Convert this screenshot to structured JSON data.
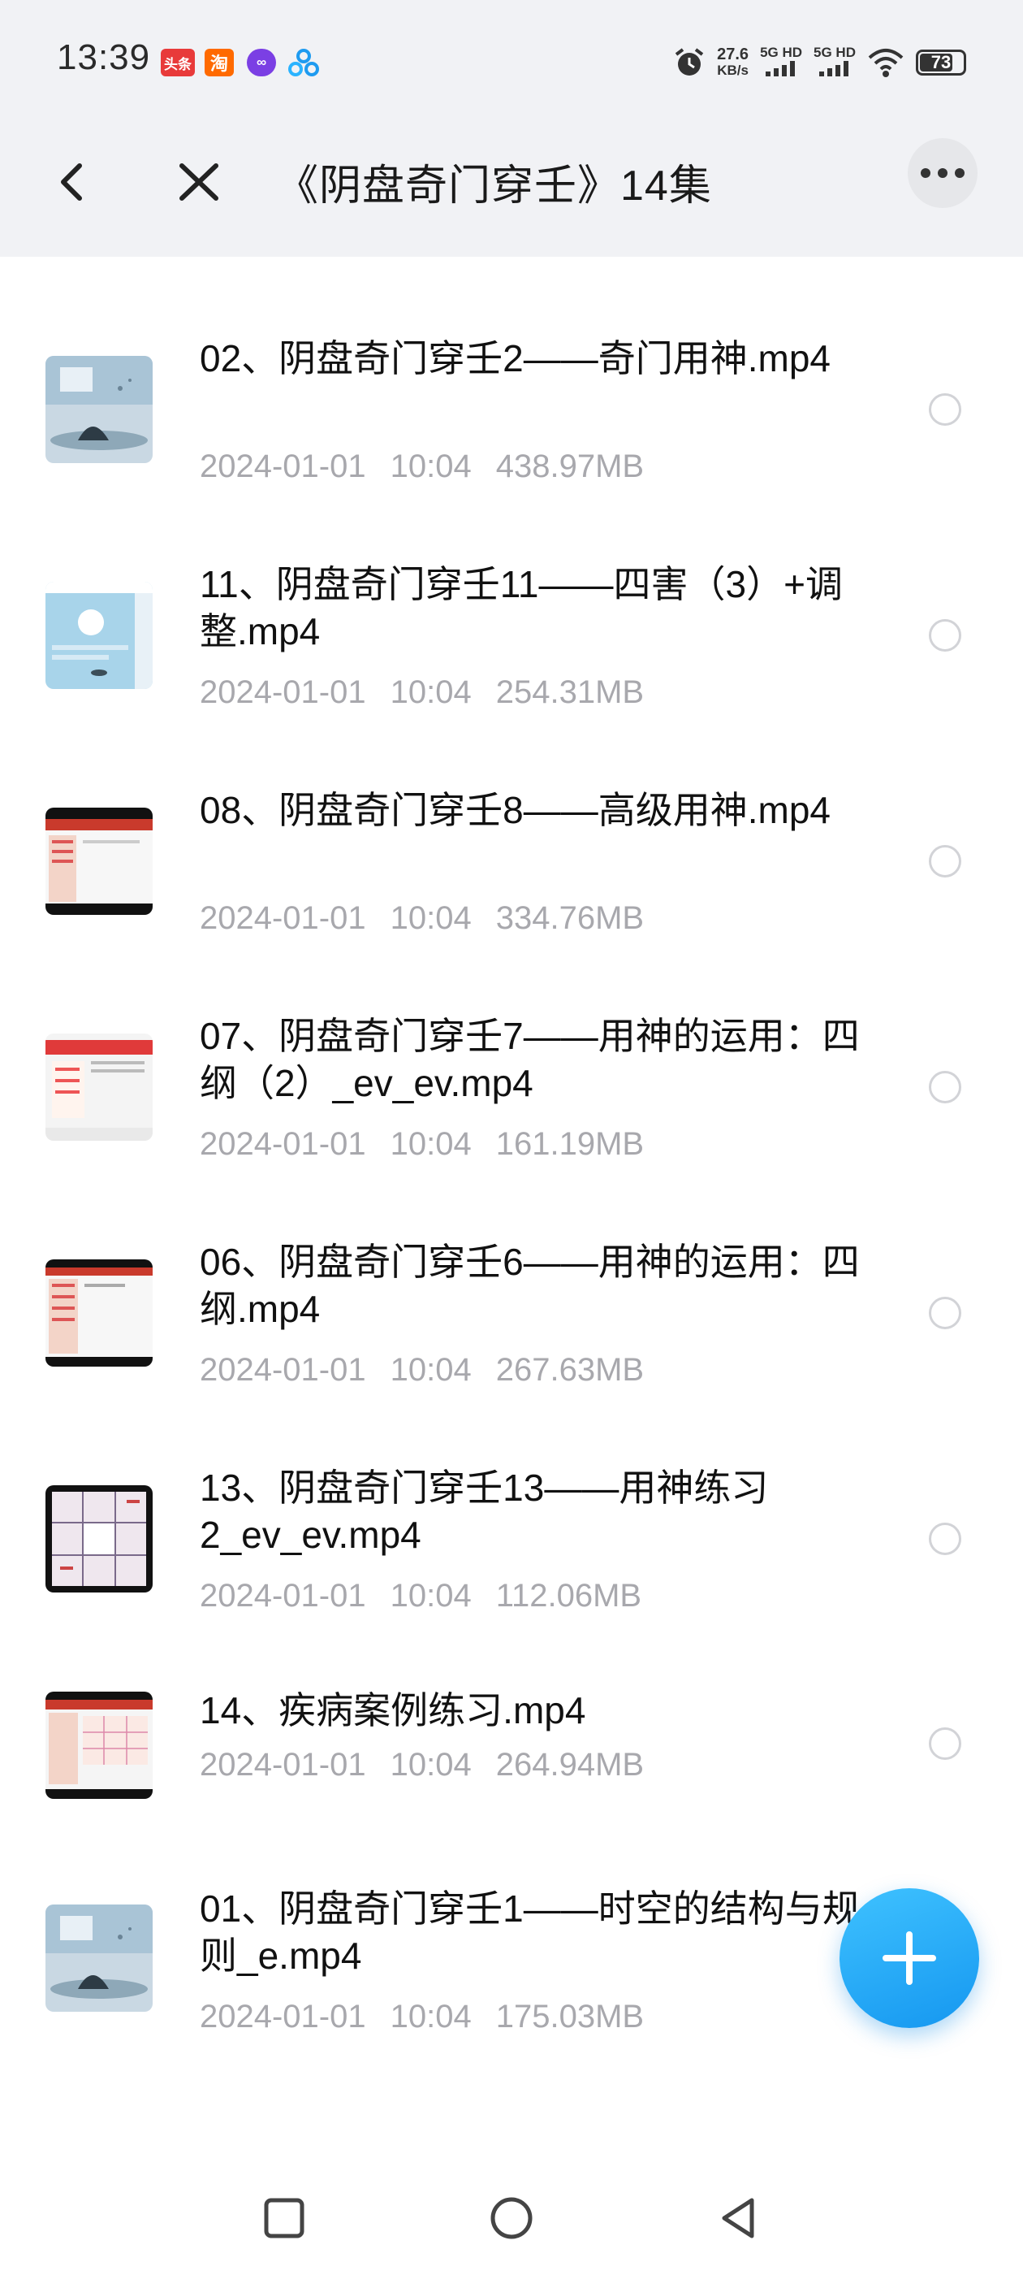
{
  "status_bar": {
    "time": "13:39",
    "apps": [
      {
        "label": "头条",
        "icon": "toutiao-icon"
      },
      {
        "label": "淘",
        "icon": "taobao-icon"
      },
      {
        "label": "∞",
        "icon": "infinity-icon"
      },
      {
        "label": "",
        "icon": "triangle-circles-icon"
      }
    ],
    "net_speed_value": "27.6",
    "net_speed_unit": "KB/s",
    "signal_1": "5G HD",
    "signal_2": "5G HD",
    "battery": "73"
  },
  "header": {
    "title": "《阴盘奇门穿壬》14集"
  },
  "files": [
    {
      "name": "02、阴盘奇门穿壬2——奇门用神.mp4",
      "date": "2024-01-01",
      "time": "10:04",
      "size": "438.97MB",
      "thumb": "landscape"
    },
    {
      "name": "11、阴盘奇门穿壬11——四害（3）+调整.mp4",
      "date": "2024-01-01",
      "time": "10:04",
      "size": "254.31MB",
      "thumb": "blue-slide"
    },
    {
      "name": "08、阴盘奇门穿壬8——高级用神.mp4",
      "date": "2024-01-01",
      "time": "10:04",
      "size": "334.76MB",
      "thumb": "red-slide"
    },
    {
      "name": "07、阴盘奇门穿壬7——用神的运用：四纲（2）_ev_ev.mp4",
      "date": "2024-01-01",
      "time": "10:04",
      "size": "161.19MB",
      "thumb": "red-slide"
    },
    {
      "name": "06、阴盘奇门穿壬6——用神的运用：四纲.mp4",
      "date": "2024-01-01",
      "time": "10:04",
      "size": "267.63MB",
      "thumb": "red-slide"
    },
    {
      "name": "13、阴盘奇门穿壬13——用神练习2_ev_ev.mp4",
      "date": "2024-01-01",
      "time": "10:04",
      "size": "112.06MB",
      "thumb": "grid-slide"
    },
    {
      "name": "14、疾病案例练习.mp4",
      "date": "2024-01-01",
      "time": "10:04",
      "size": "264.94MB",
      "thumb": "red-slide"
    },
    {
      "name": "01、阴盘奇门穿壬1——时空的结构与规则_e.mp4",
      "date": "2024-01-01",
      "time": "10:04",
      "size": "175.03MB",
      "thumb": "landscape"
    }
  ],
  "fab": {
    "icon": "plus-icon"
  },
  "nav": {
    "icons": [
      "recent-apps-icon",
      "home-icon",
      "back-icon"
    ]
  }
}
